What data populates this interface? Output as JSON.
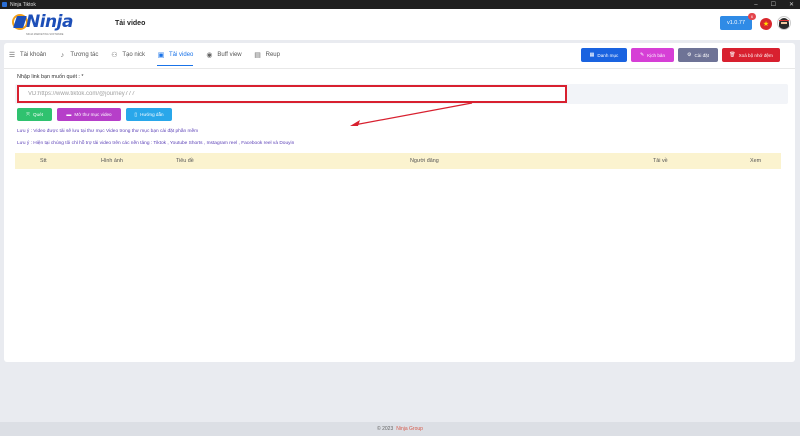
{
  "window": {
    "title": "Ninja Tiktok"
  },
  "header": {
    "logo_text": "Ninja",
    "logo_tagline": "NINJA MARKETING SOFTWARE",
    "page_title": "Tải video",
    "version": "v1.0.77",
    "version_badge": "6"
  },
  "tabs": [
    {
      "label": "Tài khoản",
      "icon": "list-icon"
    },
    {
      "label": "Tương tác",
      "icon": "tiktok-icon"
    },
    {
      "label": "Tạo nick",
      "icon": "user-plus-icon"
    },
    {
      "label": "Tải video",
      "icon": "film-icon",
      "active": true
    },
    {
      "label": "Buff view",
      "icon": "eye-icon"
    },
    {
      "label": "Reup",
      "icon": "file-icon"
    }
  ],
  "actions": [
    {
      "label": "Danh mục",
      "color": "#1a63e0"
    },
    {
      "label": "Kịch bản",
      "color": "#d63fd6"
    },
    {
      "label": "Cài đặt",
      "color": "#6e7396"
    },
    {
      "label": "Xoá bộ nhớ đệm",
      "color": "#d8202f"
    }
  ],
  "form": {
    "link_label": "Nhập link bạn muốn quét : *",
    "link_placeholder": "VD:https://www.tiktok.com/@journey777",
    "link_value": ""
  },
  "buttons": {
    "scan": {
      "label": "Quét",
      "color": "#2fc26f"
    },
    "open_folder": {
      "label": "Mở thư mục video",
      "color": "#b63fc9"
    },
    "guide": {
      "label": "Hướng dẫn",
      "color": "#29a7ea"
    }
  },
  "notes": {
    "note1": "Lưu ý : Video được tải sẽ lưu tại thư mục Video trong thư mục bạn cài đặt phần mềm",
    "note2": "Lưu ý : Hiện tại chúng tôi chỉ hỗ trợ tải video trên các nền tảng : Tiktok , Youtube Shorts , Instagram reel , Facebook reel và Douyin"
  },
  "table": {
    "columns": [
      "Stt",
      "Hình ảnh",
      "Tiêu đề",
      "Người đăng",
      "Tải về",
      "Xem"
    ],
    "rows": []
  },
  "footer": {
    "copyright": "© 2023",
    "brand": "Ninja Group"
  },
  "colors": {
    "accent": "#1a73e8",
    "highlight_red": "#d8202f",
    "table_header": "#fbf3cf"
  }
}
